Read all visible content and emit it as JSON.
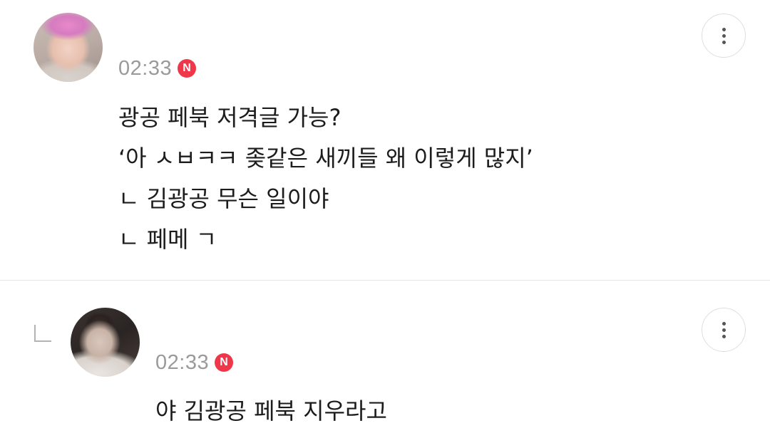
{
  "comments": [
    {
      "avatar_icon": "user-avatar-photo",
      "time": "02:33",
      "badge": "N",
      "lines": [
        "광공 페북 저격글 가능?",
        "‘아 ㅅㅂㅋㅋ 좆같은 새끼들 왜 이렇게 많지’",
        "ㄴ 김광공 무슨 일이야",
        "ㄴ 페메 ㄱ"
      ],
      "more_icon": "more-vertical-icon"
    },
    {
      "is_reply": true,
      "reply_icon": "reply-arrow-icon",
      "avatar_icon": "user-avatar-photo",
      "time": "02:33",
      "badge": "N",
      "lines": [
        "야 김광공 페북 지우라고"
      ],
      "more_icon": "more-vertical-icon"
    }
  ],
  "colors": {
    "badge": "#f0374a",
    "time": "#9a9a9a",
    "text": "#1c1c1c",
    "divider": "#e6e6e6"
  }
}
